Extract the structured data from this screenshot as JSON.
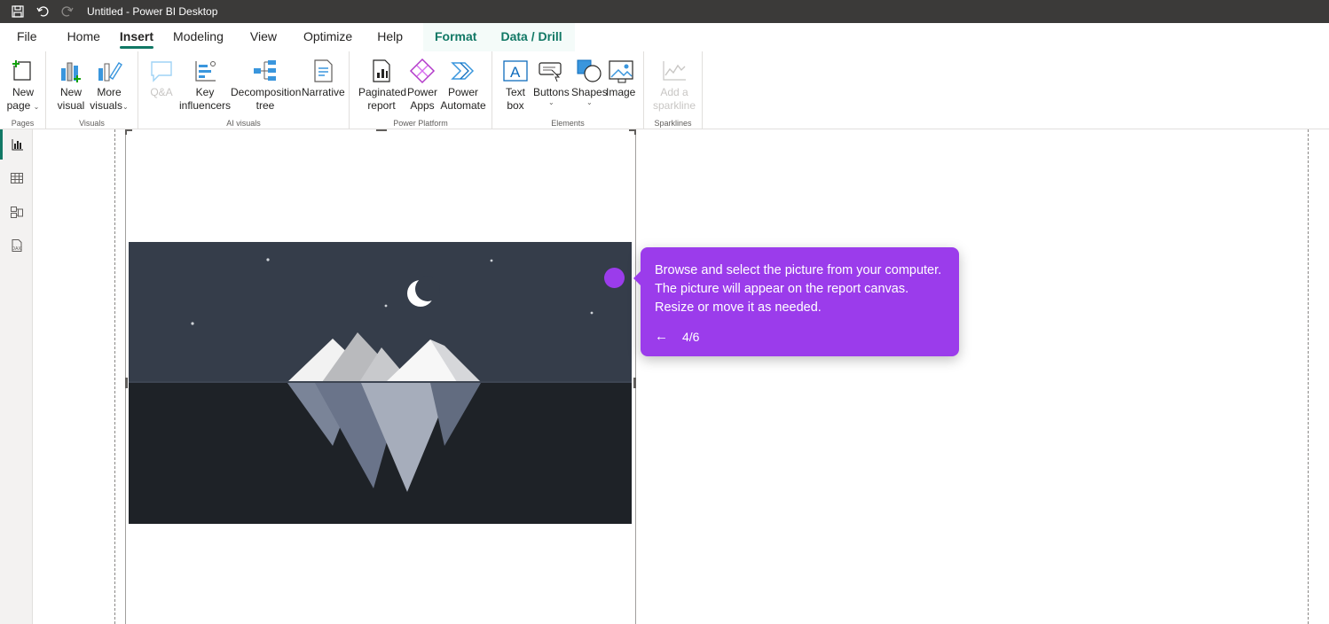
{
  "window": {
    "title": "Untitled - Power BI Desktop"
  },
  "menu": {
    "tabs": [
      {
        "label": "File"
      },
      {
        "label": "Home"
      },
      {
        "label": "Insert"
      },
      {
        "label": "Modeling"
      },
      {
        "label": "View"
      },
      {
        "label": "Optimize"
      },
      {
        "label": "Help"
      },
      {
        "label": "Format"
      },
      {
        "label": "Data / Drill"
      }
    ],
    "active": "Insert"
  },
  "ribbon": {
    "pages": {
      "label": "Pages",
      "new_page": "New page"
    },
    "visuals": {
      "label": "Visuals",
      "new_visual": "New visual",
      "more_visuals": "More visuals"
    },
    "ai_visuals": {
      "label": "AI visuals",
      "qa": "Q&A",
      "key_influencers": "Key influencers",
      "decomposition_tree": "Decomposition tree",
      "narrative": "Narrative"
    },
    "power_platform": {
      "label": "Power Platform",
      "paginated_report": "Paginated report",
      "power_apps": "Power Apps",
      "power_automate": "Power Automate"
    },
    "elements": {
      "label": "Elements",
      "text_box": "Text box",
      "buttons": "Buttons",
      "shapes": "Shapes",
      "image": "Image"
    },
    "sparklines": {
      "label": "Sparklines",
      "add_sparkline": "Add a sparkline"
    }
  },
  "leftnav": {
    "items": [
      "report-view-icon",
      "table-view-icon",
      "model-view-icon",
      "dax-query-icon"
    ],
    "active": "report-view-icon"
  },
  "tooltip": {
    "text": "Browse and select the picture from your computer. The picture will appear on the report canvas. Resize or move it as needed.",
    "back_icon": "←",
    "step": "4/6"
  },
  "colors": {
    "accent": "#117865",
    "tooltip": "#9b3ceb",
    "titlebar": "#3b3a39"
  }
}
